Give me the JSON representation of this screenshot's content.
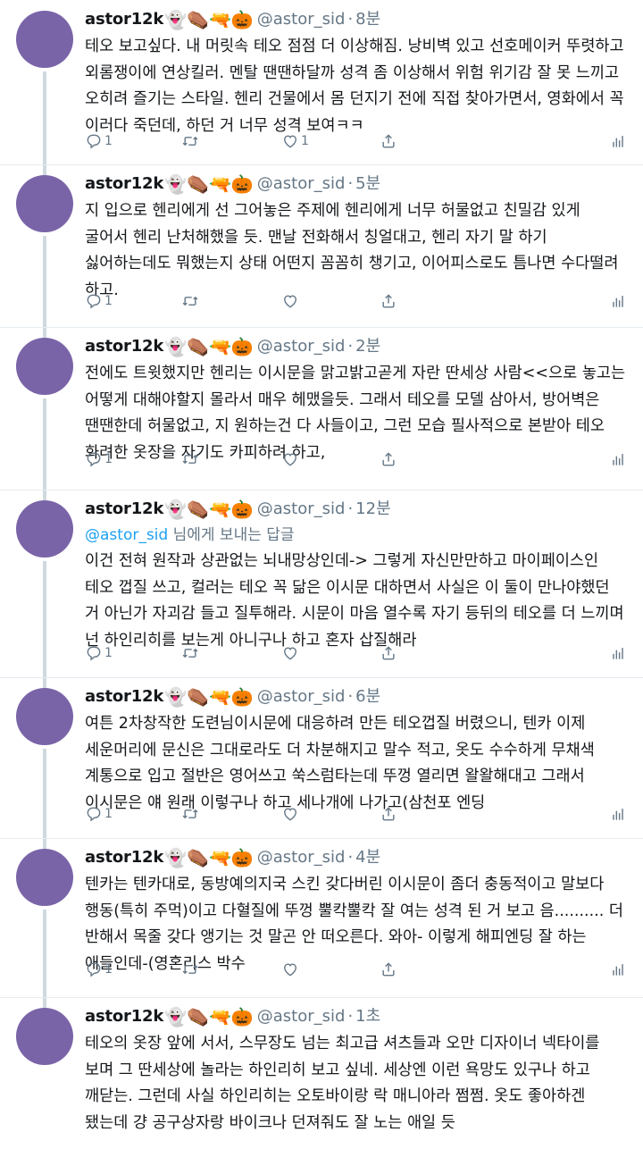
{
  "tweets": [
    {
      "name": "astor12k",
      "emojis": "👻⚰️🔫🎃",
      "handle": "@astor_sid",
      "dot": "·",
      "time": "8분",
      "reply_to": null,
      "text": "테오 보고싶다. 내 머릿속 테오 점점 더 이상해짐. 낭비벽 있고 선호메이커 뚜렷하고 외롬쟁이에 연상킬러. 멘탈 땐땐하달까 성격 좀 이상해서 위험 위기감 잘 못 느끼고 오히려 즐기는 스타일. 헨리 건물에서 몸 던지기 전에 직접 찾아가면서, 영화에서 꼭 이러다 죽던데, 하던 거 너무 성격 보여ㅋㅋ",
      "reply_count": "1",
      "like_count": "1"
    },
    {
      "name": "astor12k",
      "emojis": "👻⚰️🔫🎃",
      "handle": "@astor_sid",
      "dot": "·",
      "time": "5분",
      "reply_to": null,
      "text": "지 입으로 헨리에게 선 그어놓은 주제에 헨리에게 너무 허물없고 친밀감 있게 굴어서 헨리 난처해했을 듯. 맨날 전화해서 칭얼대고, 헨리 자기 말 하기 싫어하는데도 뭐했는지 상태 어떤지 꼼꼼히 챙기고, 이어피스로도 틈나면 수다떨려 하고.",
      "reply_count": "1",
      "like_count": ""
    },
    {
      "name": "astor12k",
      "emojis": "👻⚰️🔫🎃",
      "handle": "@astor_sid",
      "dot": "·",
      "time": "2분",
      "reply_to": null,
      "text": "전에도 트윗했지만 헨리는 이시문을 맑고밝고곧게 자란 딴세상 사람<<으로 놓고는 어떻게 대해야할지 몰라서 매우 헤맸을듯. 그래서 테오를 모델 삼아서, 방어벽은 땐땐한데 허물없고, 지 원하는건 다 사들이고, 그런 모습 필사적으로 본받아 테오 화려한 옷장을 자기도 카피하려 하고,",
      "reply_count": "1",
      "like_count": ""
    },
    {
      "name": "astor12k",
      "emojis": "👻⚰️🔫🎃",
      "handle": "@astor_sid",
      "dot": "·",
      "time": "12분",
      "reply_to": {
        "mention": "@astor_sid",
        "suffix": " 님에게 보내는 답글"
      },
      "text": "이건 전혀 원작과 상관없는 뇌내망상인데-> 그렇게 자신만만하고 마이페이스인 테오 껍질 쓰고, 컬러는 테오 꼭 닮은 이시문 대하면서 사실은 이 둘이 만나야했던 거 아닌가 자괴감 들고 질투해라. 시문이 마음 열수록 자기 등뒤의 테오를 더 느끼며 넌 하인리히를 보는게 아니구나 하고 혼자 삽질해라",
      "reply_count": "1",
      "like_count": ""
    },
    {
      "name": "astor12k",
      "emojis": "👻⚰️🔫🎃",
      "handle": "@astor_sid",
      "dot": "·",
      "time": "6분",
      "reply_to": null,
      "text": "여튼 2차창작한 도련님이시문에 대응하려 만든 테오껍질 버렸으니, 텐카 이제 세운머리에 문신은 그대로라도 더 차분해지고 말수 적고, 옷도 수수하게 무채색 계통으로 입고 절반은 영어쓰고 쑥스럼타는데 뚜껑 열리면 왈왈해대고 그래서 이시문은 얘 원래 이렇구나 하고 세나개에 나가고(삼천포 엔딩",
      "reply_count": "1",
      "like_count": ""
    },
    {
      "name": "astor12k",
      "emojis": "👻⚰️🔫🎃",
      "handle": "@astor_sid",
      "dot": "·",
      "time": "4분",
      "reply_to": null,
      "text": "텐카는 텐카대로, 동방예의지국 스킨 갖다버린 이시문이 좀더 충동적이고 말보다 행동(특히 주먹)이고 다혈질에 뚜껑 뿔칵뿔칵 잘 여는 성격 된 거 보고 음.......... 더 반해서 목줄 갖다 앵기는 것 말곤 안 떠오른다. 와아- 이렇게 해피엔딩 잘 하는 애들인데-(영혼리스 박수",
      "reply_count": "1",
      "like_count": ""
    },
    {
      "name": "astor12k",
      "emojis": "👻⚰️🔫🎃",
      "handle": "@astor_sid",
      "dot": "·",
      "time": "1초",
      "reply_to": null,
      "text": "테오의 옷장 앞에 서서, 스무장도 넘는 최고급 셔츠들과 오만 디자이너 넥타이를 보며 그 딴세상에 놀라는 하인리히 보고 싶네. 세상엔 이런 욕망도 있구나 하고 깨닫는. 그런데 사실 하인리히는 오토바이랑 락 매니아라 쩜쩜. 옷도 좋아하겐 됐는데 걍 공구상자랑 바이크나 던져줘도 잘 노는 애일 듯",
      "reply_count": "",
      "like_count": ""
    }
  ],
  "icons": {
    "reply": "reply-icon",
    "retweet": "retweet-icon",
    "like": "heart-icon",
    "share": "share-icon",
    "stats": "analytics-icon"
  },
  "colors": {
    "avatar": "#7a64a8",
    "thread_line": "#cfd9de",
    "mention": "#1da1f2",
    "secondary_text": "#657786"
  }
}
